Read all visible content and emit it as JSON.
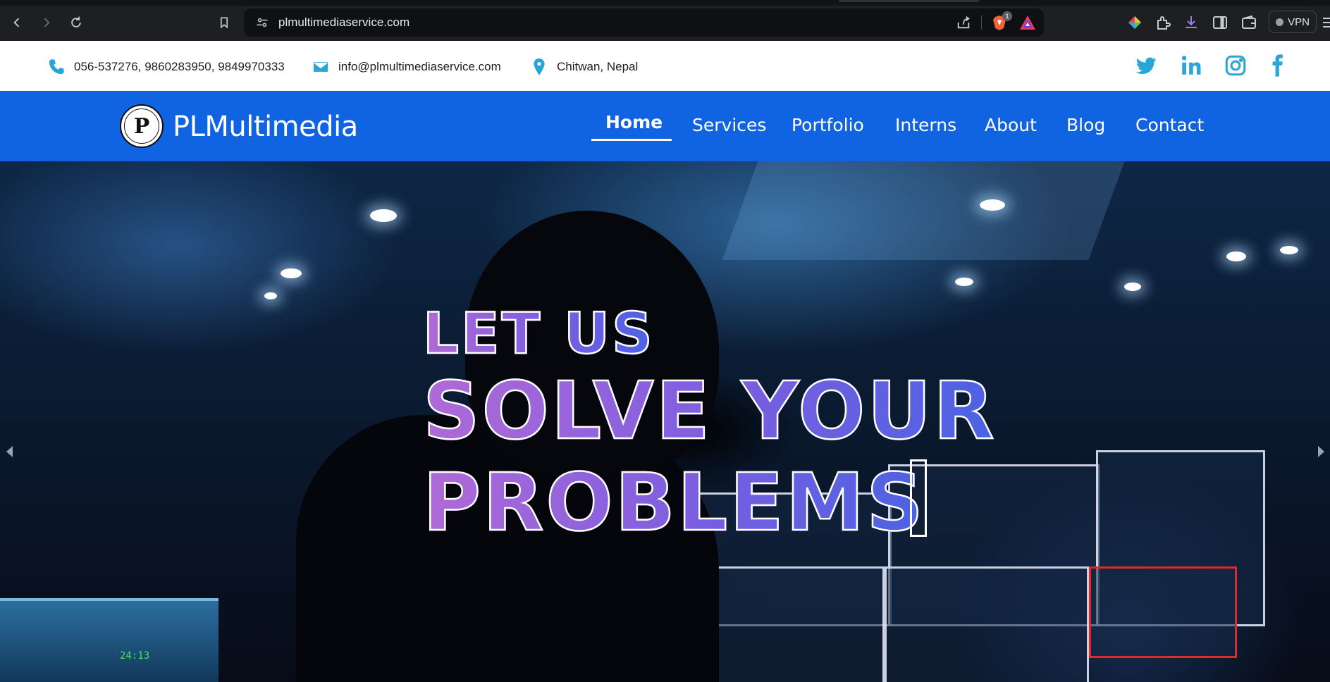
{
  "browser": {
    "url": "plmultimediaservice.com",
    "brave_shield_count": "1",
    "vpn_label": "VPN"
  },
  "contact_bar": {
    "phone": "056-537276, 9860283950, 9849970333",
    "email": "info@plmultimediaservice.com",
    "location": "Chitwan, Nepal",
    "social": [
      "twitter-icon",
      "linkedin-icon",
      "instagram-icon",
      "facebook-icon"
    ],
    "accent_color": "#2aa5d8"
  },
  "nav": {
    "logo_letter": "P",
    "brand": "PLMultimedia",
    "items": [
      "Home",
      "Services",
      "Portfolio",
      "Interns",
      "About",
      "Blog",
      "Contact"
    ],
    "active": "Home",
    "background": "#1164e1"
  },
  "hero": {
    "line1": "LET US",
    "line2": "SOLVE YOUR",
    "line3": "PROBLEMS",
    "gradient_start": "#b06ad6",
    "gradient_end": "#4b63e3",
    "laptop_timer": "24:13"
  }
}
